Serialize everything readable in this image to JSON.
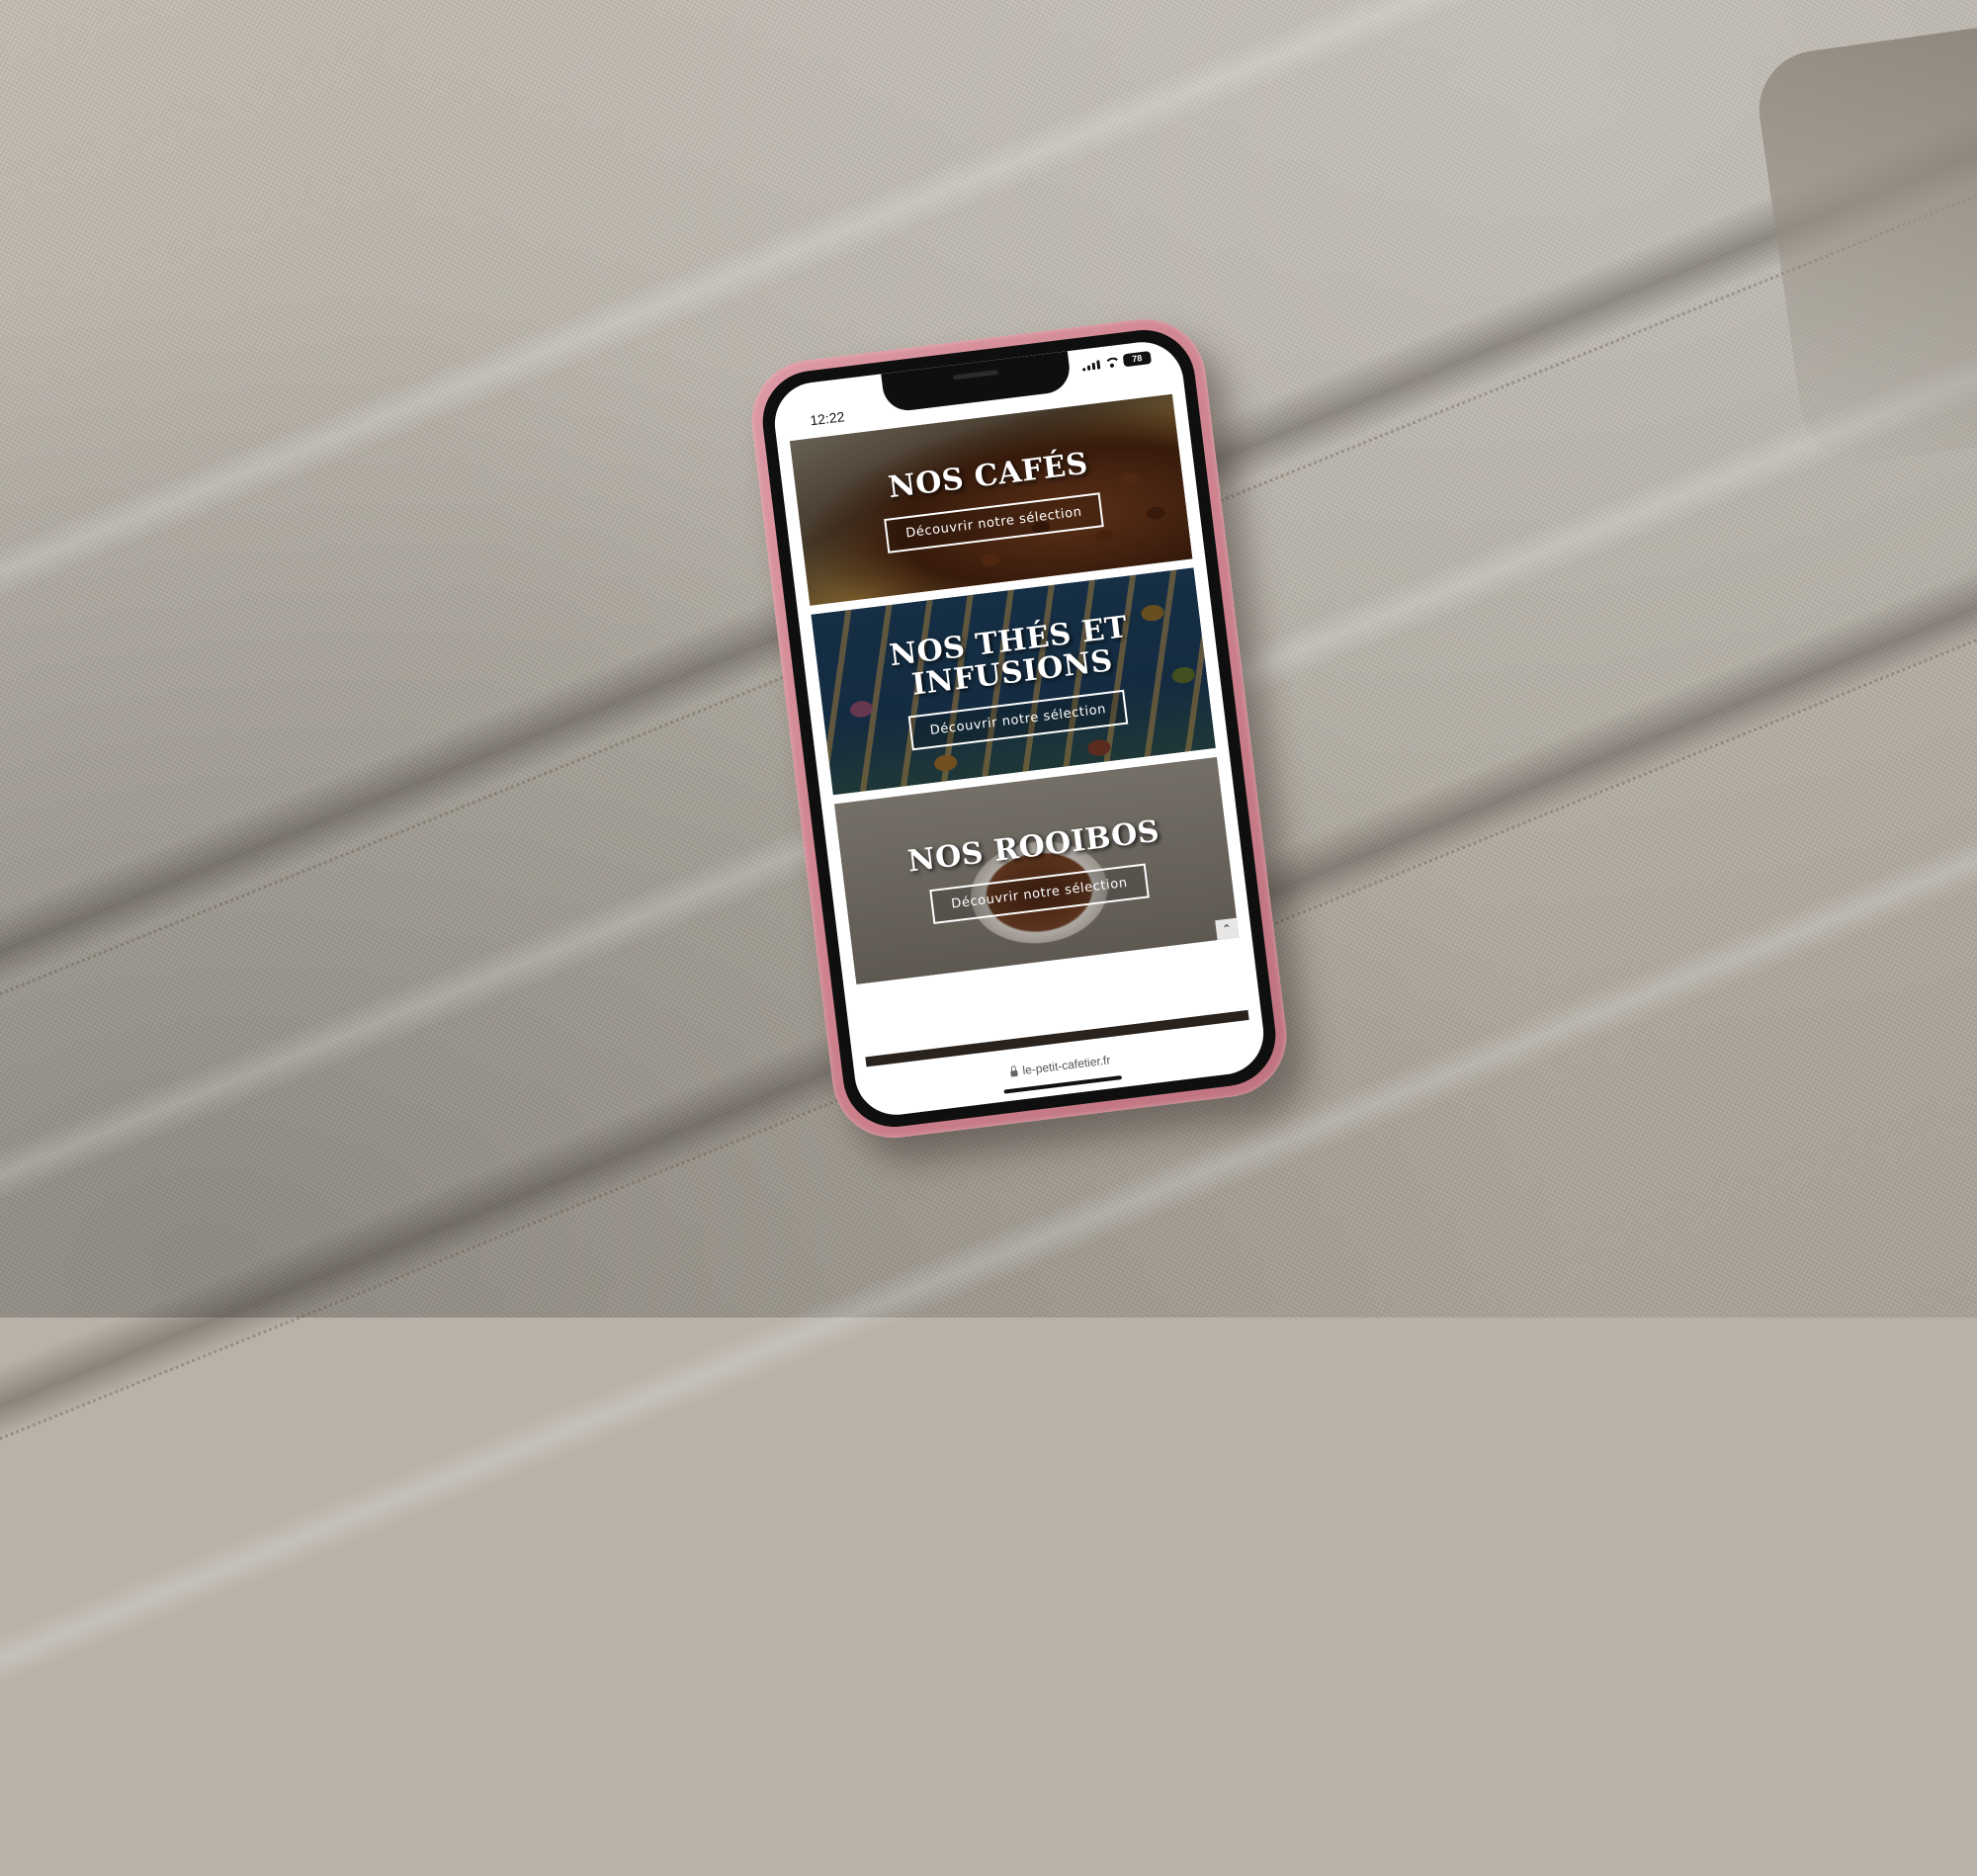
{
  "status_bar": {
    "time": "12:22",
    "battery": "78"
  },
  "categories": [
    {
      "title": "NOS CAFÉS",
      "button_label": "Découvrir notre sélection",
      "image": "coffee-beans-photo"
    },
    {
      "title": "NOS THÉS ET INFUSIONS",
      "button_label": "Découvrir notre sélection",
      "image": "tea-spoons-photo"
    },
    {
      "title": "NOS ROOIBOS",
      "button_label": "Découvrir notre sélection",
      "image": "rooibos-cup-photo"
    }
  ],
  "browser": {
    "url": "le-petit-cafetier.fr"
  },
  "colors": {
    "phone_case": "#cf848f",
    "backdrop": "#b8b2a8",
    "button_border": "#ffffff"
  },
  "icons": [
    "signal-icon",
    "wifi-icon",
    "battery-icon",
    "lock-icon",
    "scroll-to-top-icon"
  ]
}
